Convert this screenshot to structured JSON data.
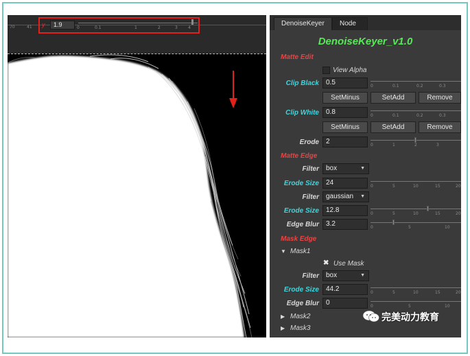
{
  "viewer": {
    "left_ruler": [
      "70",
      "41"
    ],
    "gamma": {
      "label": "y",
      "value": "1.9",
      "ticks": [
        "0",
        "0.1",
        "1",
        "2",
        "3",
        "4"
      ],
      "handle_position": 0.95
    },
    "arrow_color": "#e2201c"
  },
  "panel": {
    "tabs": [
      {
        "label": "DenoiseKeyer",
        "active": true
      },
      {
        "label": "Node",
        "active": false
      }
    ],
    "title": "DenoiseKeyer_v1.0",
    "matte_edit": {
      "header": "Matte Edit",
      "view_alpha": {
        "label": "View Alpha",
        "checked": false
      },
      "clip_black": {
        "label": "Clip Black",
        "value": "0.5",
        "ticks": [
          "0",
          "0.1",
          "0.2",
          "0.3"
        ],
        "buttons": [
          "SetMinus",
          "SetAdd",
          "Remove"
        ]
      },
      "clip_white": {
        "label": "Clip White",
        "value": "0.8",
        "ticks": [
          "0",
          "0.1",
          "0.2",
          "0.3"
        ],
        "buttons": [
          "SetMinus",
          "SetAdd",
          "Remove"
        ]
      },
      "erode": {
        "label": "Erode",
        "value": "2",
        "ticks": [
          "0",
          "1",
          "2",
          "3"
        ],
        "handle_position": 0.5
      }
    },
    "matte_edge": {
      "header": "Matte Edge",
      "filter1": {
        "label": "Filter",
        "value": "box"
      },
      "erode_size1": {
        "label": "Erode Size",
        "value": "24",
        "ticks": [
          "0",
          "5",
          "10",
          "15",
          "20"
        ]
      },
      "filter2": {
        "label": "Filter",
        "value": "gaussian"
      },
      "erode_size2": {
        "label": "Erode Size",
        "value": "12.8",
        "ticks": [
          "0",
          "5",
          "10",
          "15",
          "20"
        ],
        "handle_position": 0.64
      },
      "edge_blur": {
        "label": "Edge Blur",
        "value": "3.2",
        "ticks": [
          "0",
          "5",
          "10"
        ],
        "handle_position": 0.25
      }
    },
    "mask_edge": {
      "header": "Mask Edge",
      "mask1": {
        "label": "Mask1",
        "use_mask": {
          "label": "Use Mask",
          "checked": true
        },
        "filter": {
          "label": "Filter",
          "value": "box"
        },
        "erode_size": {
          "label": "Erode Size",
          "value": "44.2",
          "ticks": [
            "0",
            "5",
            "10",
            "15",
            "20"
          ]
        },
        "edge_blur": {
          "label": "Edge Blur",
          "value": "0",
          "ticks": [
            "0",
            "5",
            "10"
          ]
        }
      },
      "mask2": {
        "label": "Mask2"
      },
      "mask3": {
        "label": "Mask3"
      }
    }
  },
  "watermark": {
    "text": "完美动力教育"
  },
  "colors": {
    "accent_green": "#58e858",
    "section_red": "#e64545",
    "label_cyan": "#39d8e0",
    "highlight_red": "#e2201c",
    "frame_teal": "#74c8c2"
  }
}
